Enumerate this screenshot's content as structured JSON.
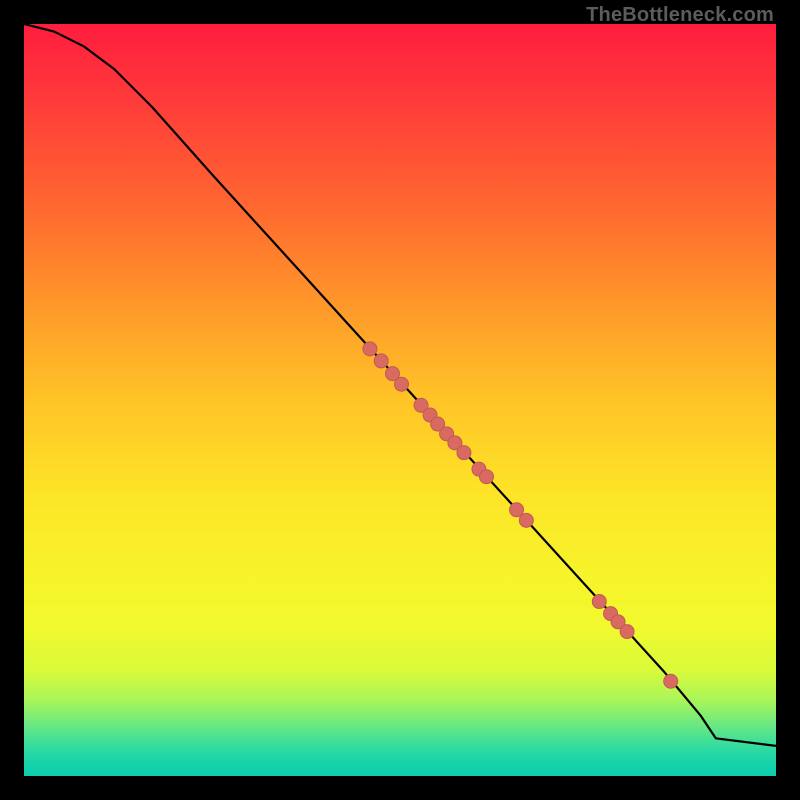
{
  "watermark": "TheBottleneck.com",
  "colors": {
    "background": "#000000",
    "curve": "#000000",
    "marker_fill": "#d86a62",
    "marker_stroke": "#c15a53"
  },
  "chart_data": {
    "type": "line",
    "title": "",
    "xlabel": "",
    "ylabel": "",
    "xlim": [
      0,
      100
    ],
    "ylim": [
      0,
      100
    ],
    "grid": false,
    "series": [
      {
        "name": "curve",
        "x": [
          0,
          4,
          8,
          12,
          17,
          25,
          35,
          45,
          55,
          65,
          75,
          85,
          90,
          92,
          100
        ],
        "values": [
          100,
          99,
          97,
          94,
          89,
          80,
          69,
          58,
          47,
          36,
          25,
          14,
          8,
          5,
          4
        ]
      }
    ],
    "markers": [
      {
        "x": 46.0,
        "y": 56.8
      },
      {
        "x": 47.5,
        "y": 55.2
      },
      {
        "x": 49.0,
        "y": 53.5
      },
      {
        "x": 50.2,
        "y": 52.1
      },
      {
        "x": 52.8,
        "y": 49.3
      },
      {
        "x": 54.0,
        "y": 48.0
      },
      {
        "x": 55.0,
        "y": 46.8
      },
      {
        "x": 56.2,
        "y": 45.5
      },
      {
        "x": 57.3,
        "y": 44.3
      },
      {
        "x": 58.5,
        "y": 43.0
      },
      {
        "x": 60.5,
        "y": 40.8
      },
      {
        "x": 61.5,
        "y": 39.8
      },
      {
        "x": 65.5,
        "y": 35.4
      },
      {
        "x": 66.8,
        "y": 34.0
      },
      {
        "x": 76.5,
        "y": 23.2
      },
      {
        "x": 78.0,
        "y": 21.6
      },
      {
        "x": 79.0,
        "y": 20.5
      },
      {
        "x": 80.2,
        "y": 19.2
      },
      {
        "x": 86.0,
        "y": 12.6
      }
    ],
    "marker_radius_px": 7
  }
}
